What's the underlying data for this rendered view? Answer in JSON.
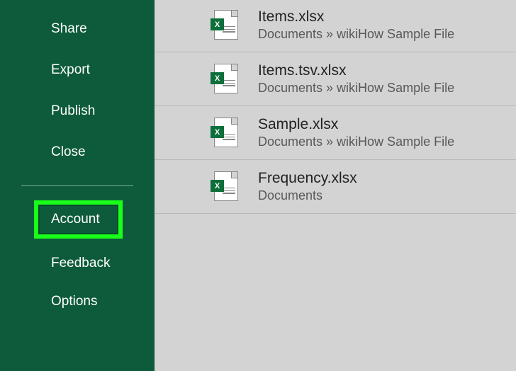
{
  "sidebar": {
    "top": [
      {
        "label": "Share"
      },
      {
        "label": "Export"
      },
      {
        "label": "Publish"
      },
      {
        "label": "Close"
      }
    ],
    "highlighted": {
      "label": "Account"
    },
    "bottom": [
      {
        "label": "Feedback"
      },
      {
        "label": "Options"
      }
    ]
  },
  "files": [
    {
      "name": "Items.xlsx",
      "path": "Documents » wikiHow Sample File"
    },
    {
      "name": "Items.tsv.xlsx",
      "path": "Documents » wikiHow Sample File"
    },
    {
      "name": "Sample.xlsx",
      "path": "Documents » wikiHow Sample File"
    },
    {
      "name": "Frequency.xlsx",
      "path": "Documents"
    }
  ]
}
